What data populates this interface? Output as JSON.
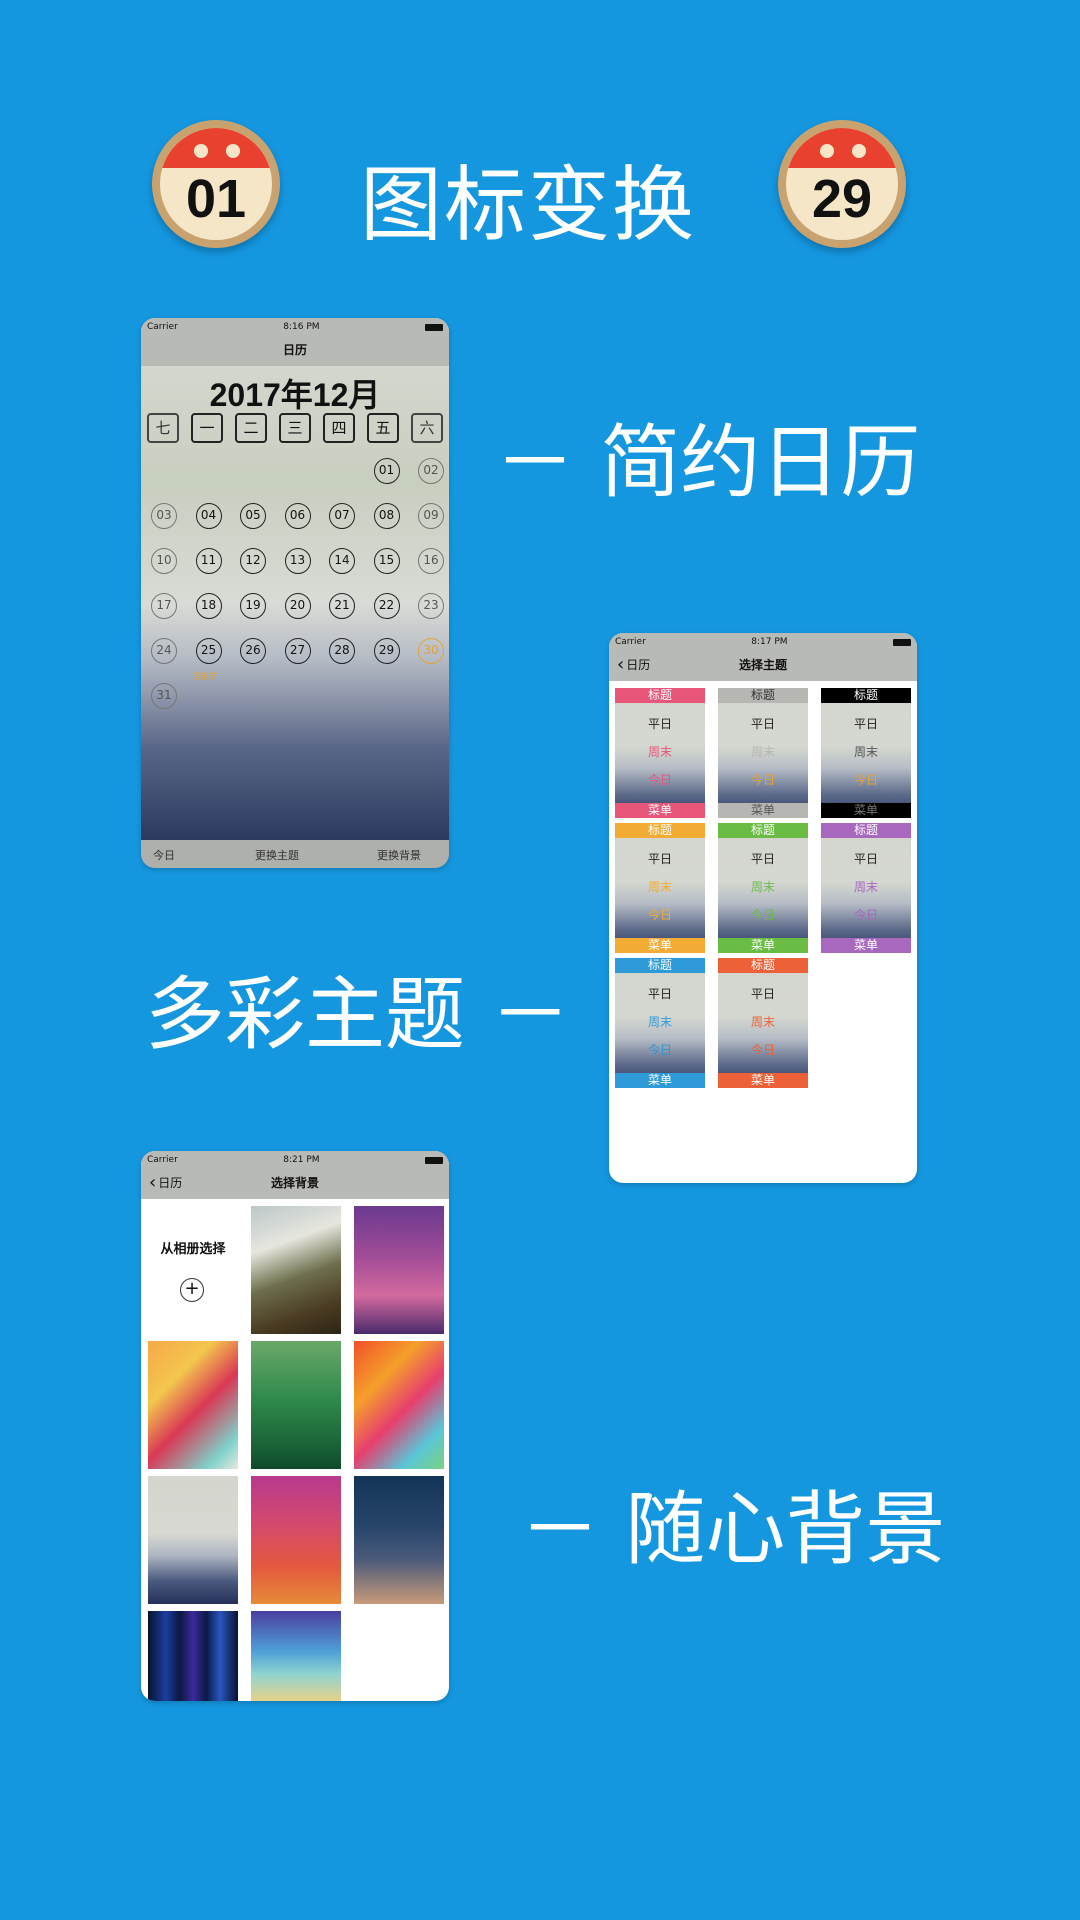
{
  "colors": {
    "page_bg": "#1597e0",
    "accent_orange": "#e2a336"
  },
  "header": {
    "badge_left": "01",
    "title": "图标变换",
    "badge_right": "29"
  },
  "captions": {
    "simple_calendar": "－ 简约日历",
    "colorful_theme": "多彩主题 －",
    "free_background": "－ 随心背景"
  },
  "phone1": {
    "carrier": "Carrier",
    "time": "8:16 PM",
    "nav_title": "日历",
    "month_title": "2017年12月",
    "weekdays": [
      "七",
      "一",
      "二",
      "三",
      "四",
      "五",
      "六"
    ],
    "days": [
      "01",
      "02",
      "03",
      "04",
      "05",
      "06",
      "07",
      "08",
      "09",
      "10",
      "11",
      "12",
      "13",
      "14",
      "15",
      "16",
      "17",
      "18",
      "19",
      "20",
      "21",
      "22",
      "23",
      "24",
      "25",
      "26",
      "27",
      "28",
      "29",
      "30",
      "31"
    ],
    "festival": "圣诞节",
    "tab_today": "今日",
    "tab_theme": "更换主题",
    "tab_background": "更换背景"
  },
  "phone2": {
    "carrier": "Carrier",
    "time": "8:17 PM",
    "back": "日历",
    "nav_title": "选择主题",
    "themes": [
      {
        "title": "标题",
        "weekday": "平日",
        "weekend": "周末",
        "today": "今日",
        "menu": "菜单",
        "color": "#e8567a"
      },
      {
        "title": "标题",
        "weekday": "平日",
        "weekend": "周末",
        "today": "今日",
        "menu": "菜单",
        "color": "#b6b6b3"
      },
      {
        "title": "标题",
        "weekday": "平日",
        "weekend": "周末",
        "today": "今日",
        "menu": "菜单",
        "color": "#000000"
      },
      {
        "title": "标题",
        "weekday": "平日",
        "weekend": "周末",
        "today": "今日",
        "menu": "菜单",
        "color": "#f2ab33"
      },
      {
        "title": "标题",
        "weekday": "平日",
        "weekend": "周末",
        "today": "今日",
        "menu": "菜单",
        "color": "#6abc45"
      },
      {
        "title": "标题",
        "weekday": "平日",
        "weekend": "周末",
        "today": "今日",
        "menu": "菜单",
        "color": "#a868be"
      },
      {
        "title": "标题",
        "weekday": "平日",
        "weekend": "周末",
        "today": "今日",
        "menu": "菜单",
        "color": "#2e9ad7"
      },
      {
        "title": "标题",
        "weekday": "平日",
        "weekend": "周末",
        "today": "今日",
        "menu": "菜单",
        "color": "#ec6137"
      }
    ]
  },
  "phone3": {
    "carrier": "Carrier",
    "time": "8:21 PM",
    "back": "日历",
    "nav_title": "选择背景",
    "album_label": "从相册选择",
    "add_icon": "plus-circle-icon"
  }
}
